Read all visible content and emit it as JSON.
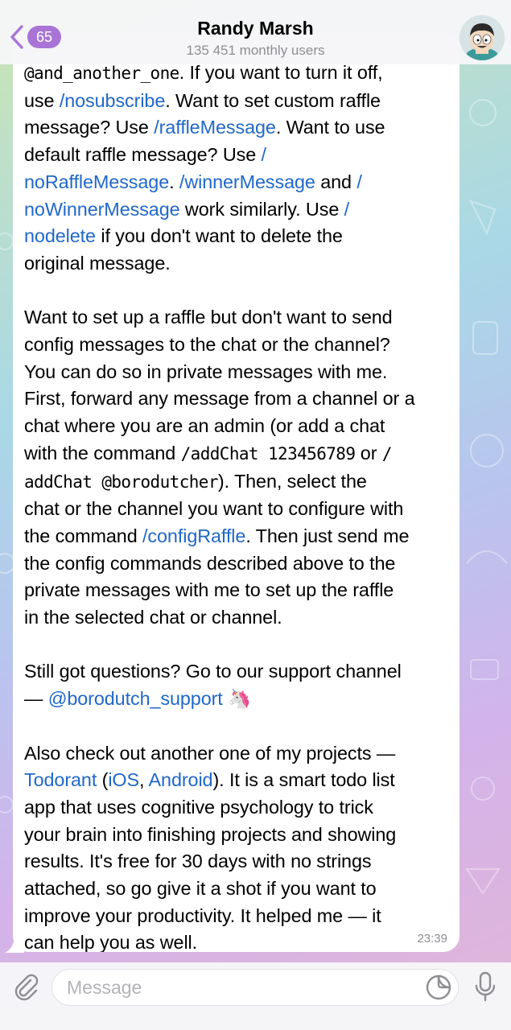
{
  "header": {
    "back_badge": "65",
    "title": "Randy Marsh",
    "subtitle": "135 451 monthly users"
  },
  "message": {
    "lines_top": {
      "l1_code": "@and_another_one",
      "l1_rest": ". If you want to turn it off,",
      "l2_pre": "use ",
      "l2_link": "/nosubscribe",
      "l2_post": ". Want to set custom raffle",
      "l3_pre": "message? Use ",
      "l3_link": "/raffleMessage",
      "l3_post": ". Want to use",
      "l4_pre": "default raffle message? Use ",
      "l4_link": "/",
      "l5_link": "noRaffleMessage",
      "l5_mid": ". ",
      "l5_link2": "/winnerMessage",
      "l5_mid2": " and ",
      "l5_link3": "/",
      "l6_link": "noWinnerMessage",
      "l6_mid": " work similarly. Use ",
      "l6_link2": "/",
      "l7_link": "nodelete",
      "l7_post": " if you don't want to delete the",
      "l8": "original message."
    },
    "para2": {
      "l1": "Want to set up a raffle but don't want to send",
      "l2": "config messages to the chat or the channel?",
      "l3": "You can do so in private messages with me.",
      "l4": "First, forward any message from a channel or a",
      "l5": "chat where you are an admin (or add a chat",
      "l6_pre": "with the command ",
      "l6_code": "/addChat 123456789",
      "l6_post": " or ",
      "l6_code2": "/",
      "l7_code": "addChat @borodutcher",
      "l7_post": "). Then, select the",
      "l8": "chat or the channel you want to configure with",
      "l9_pre": "the command ",
      "l9_link": "/configRaffle",
      "l9_post": ". Then just send me",
      "l10": "the config commands described above to the",
      "l11": "private messages with me to set up the raffle",
      "l12": "in the selected chat or channel."
    },
    "para3": {
      "l1": "Still got questions? Go to our support channel",
      "l2_pre": "— ",
      "l2_link": "@borodutch_support",
      "l2_emoji": " 🦄"
    },
    "para4": {
      "l1": "Also check out another one of my projects —",
      "l2_link": "Todorant",
      "l2_mid": " (",
      "l2_link2": "iOS",
      "l2_mid2": ", ",
      "l2_link3": "Android",
      "l2_post": "). It is a smart todo list",
      "l3": "app that uses cognitive psychology to trick",
      "l4": "your brain into finishing projects and showing",
      "l5": "results. It's free for 30 days with no strings",
      "l6": "attached, so go give it a shot if you want to",
      "l7": "improve your productivity. It helped me — it",
      "l8": "can help you as well."
    },
    "time": "23:39"
  },
  "composer": {
    "placeholder": "Message",
    "icons": [
      "paperclip-icon",
      "sticker-icon",
      "microphone-icon"
    ]
  },
  "colors": {
    "link": "#2068c9",
    "badge": "#a974d6",
    "secondary_text": "#8e8e93"
  }
}
